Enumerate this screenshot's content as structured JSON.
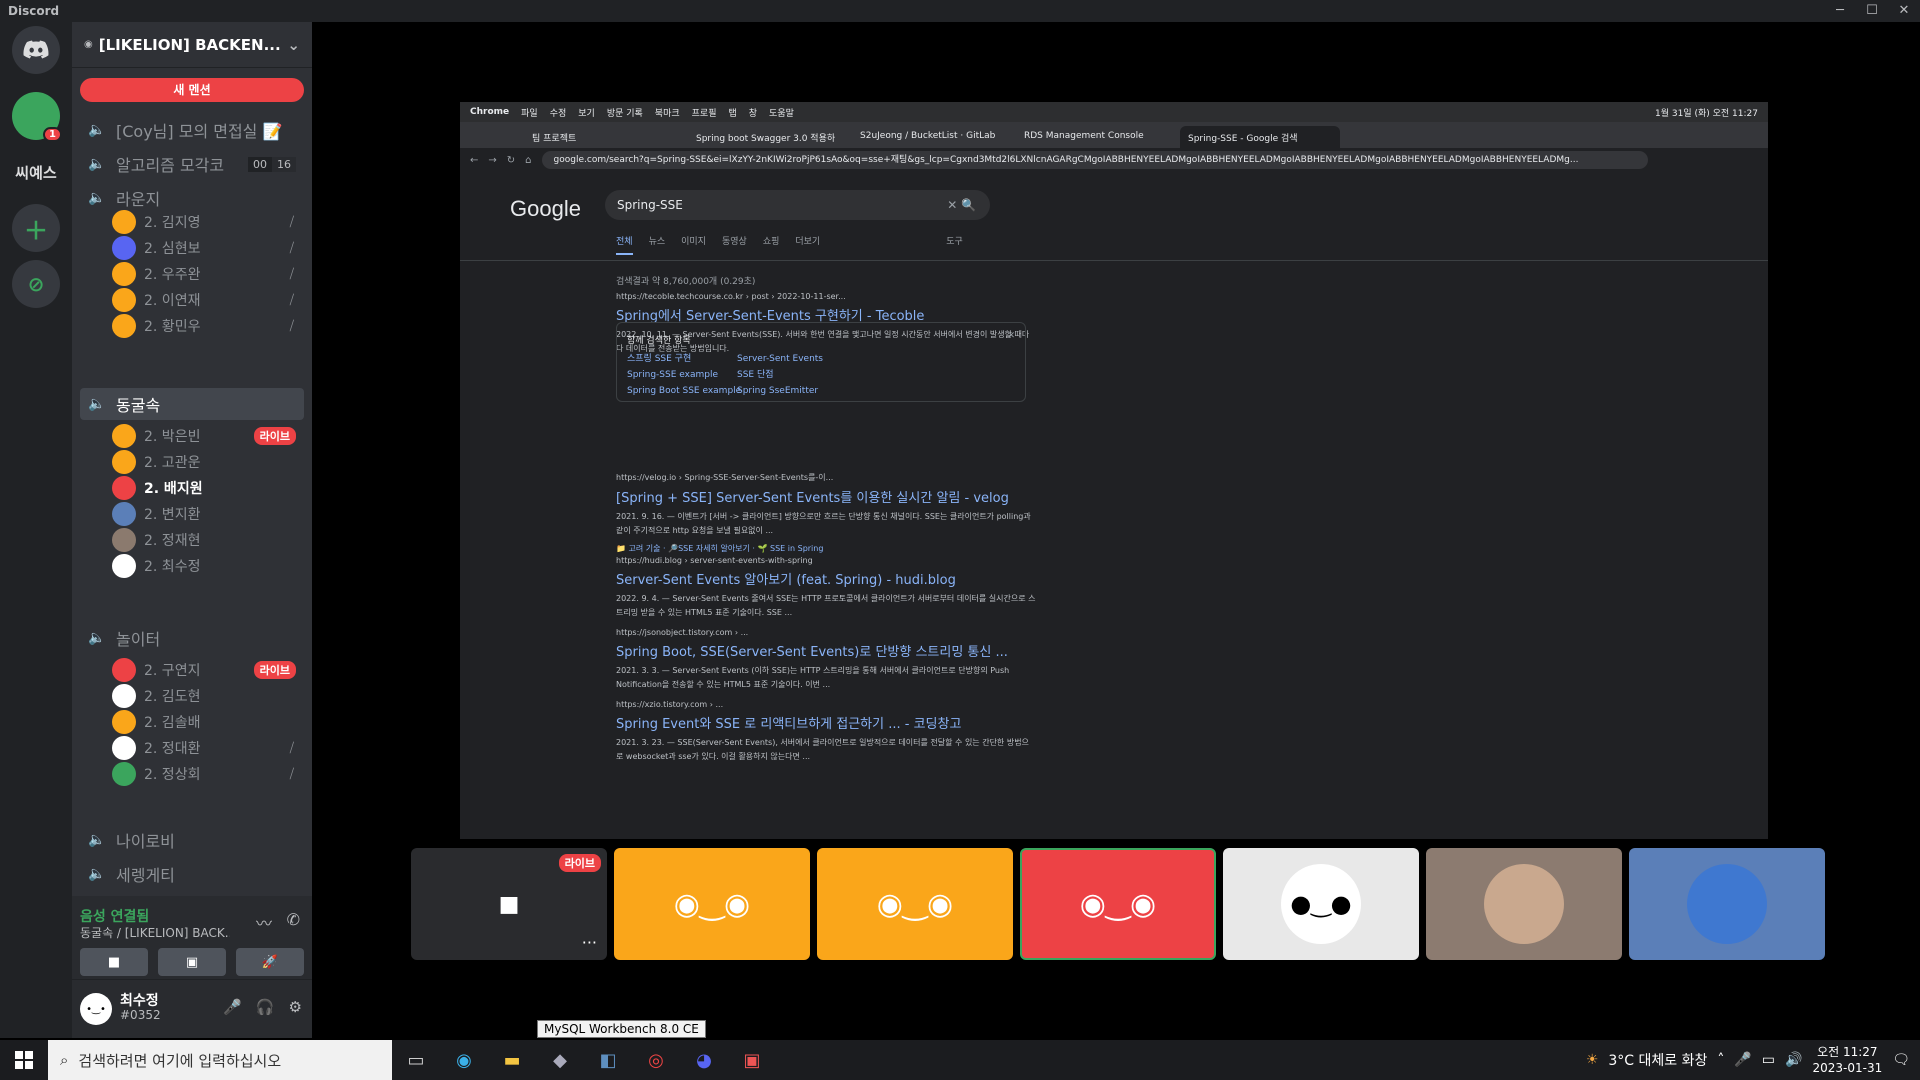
{
  "window": {
    "title": "Discord",
    "min": "─",
    "max": "☐",
    "close": "✕"
  },
  "servers": {
    "sidebar_text_server": "씨예스",
    "notification_count": "1"
  },
  "guild": {
    "name": "[LIKELION] BACKEN...",
    "new_mention": "새 멘션"
  },
  "channels": [
    {
      "label": "[Coy님] 모의 면접실 📝"
    },
    {
      "label": "알고리즘 모각코",
      "count_a": "00",
      "count_b": "16"
    },
    {
      "label": "라운지"
    },
    {
      "label": "동굴속"
    },
    {
      "label": "놀이터"
    },
    {
      "label": "나이로비"
    },
    {
      "label": "세렝게티"
    }
  ],
  "lounge_members": [
    {
      "name": "2. 김지영",
      "color": "#faa61a"
    },
    {
      "name": "2. 심현보",
      "color": "#5865f2"
    },
    {
      "name": "2. 우주완",
      "color": "#faa61a"
    },
    {
      "name": "2. 이연재",
      "color": "#faa61a"
    },
    {
      "name": "2. 황민우",
      "color": "#faa61a"
    }
  ],
  "cave_members": [
    {
      "name": "2. 박은빈",
      "live": "라이브",
      "color": "#faa61a"
    },
    {
      "name": "2. 고관운",
      "color": "#faa61a"
    },
    {
      "name": "2. 배지원",
      "color": "#ed4245"
    },
    {
      "name": "2. 변지환",
      "color": "#5b7fb8"
    },
    {
      "name": "2. 정재현",
      "color": "#8b7a6e"
    },
    {
      "name": "2. 최수정",
      "color": "#ffffff"
    }
  ],
  "play_members": [
    {
      "name": "2. 구연지",
      "live": "라이브",
      "color": "#ed4245"
    },
    {
      "name": "2. 김도현",
      "color": "#ffffff"
    },
    {
      "name": "2. 김솔배",
      "color": "#faa61a"
    },
    {
      "name": "2. 정대환",
      "color": "#ffffff"
    },
    {
      "name": "2. 정상회",
      "color": "#3ba55d"
    }
  ],
  "voice": {
    "status": "음성 연결됨",
    "sub": "동굴속 / [LIKELION] BACK..."
  },
  "user": {
    "name": "최수정",
    "tag": "#0352"
  },
  "browser": {
    "menubar": [
      "Chrome",
      "파일",
      "수정",
      "보기",
      "방문 기록",
      "북마크",
      "프로필",
      "탭",
      "창",
      "도움말"
    ],
    "menubar_right": "1월 31일 (화) 오전 11:27",
    "tabs": [
      "팀 프로젝트",
      "Spring boot Swagger 3.0 적용하",
      "S2uJeong / BucketList · GitLab",
      "RDS Management Console",
      "Spring-SSE - Google 검색"
    ],
    "url": "google.com/search?q=Spring-SSE&ei=lXzYY-2nKIWi2roPjP61sAo&oq=sse+재팅&gs_lcp=Cgxnd3Mtd2l6LXNlcnAGARgCMgoIABBHENYEELADMgoIABBHENYEELADMgoIABBHENYEELADMgoIABBHENYEELADMgoIABBHENYEELADMg..."
  },
  "google": {
    "logo": "Google",
    "query": "Spring-SSE",
    "tabs": [
      "전체",
      "뉴스",
      "이미지",
      "동영상",
      "쇼핑",
      "더보기",
      "도구"
    ],
    "count": "검색결과 약 8,760,000개 (0.29초)",
    "results": [
      {
        "url": "https://tecoble.techcourse.co.kr › post › 2022-10-11-ser...",
        "title": "Spring에서 Server-Sent-Events 구현하기 - Tecoble",
        "snippet": "2022. 10. 11. — Server-Sent Events(SSE). 서버와 한번 연결을 맺고나면 일정 시간동안 서버에서 변경이 발생할 때마다 데이터를 전송받는 방법입니다."
      },
      {
        "url": "https://velog.io › Spring-SSE-Server-Sent-Events를-이...",
        "title": "[Spring + SSE] Server-Sent Events를 이용한 실시간 알림 - velog",
        "snippet": "2021. 9. 16. — 이벤트가 [서버 -> 클라이언트] 방향으로만 흐르는 단방향 통신 채널이다. SSE는 클라이언트가 polling과 같이 주기적으로 http 요청을 보낼 필요없이 ...",
        "links": "📁 고려 기술 · 🔎SSE 자세히 알아보기 · 🌱 SSE in Spring"
      },
      {
        "url": "https://hudi.blog › server-sent-events-with-spring",
        "title": "Server-Sent Events 알아보기 (feat. Spring) - hudi.blog",
        "snippet": "2022. 9. 4. — Server-Sent Events 줄여서 SSE는 HTTP 프로토콜에서 클라이언트가 서버로부터 데이터를 실시간으로 스트리밍 받을 수 있는 HTML5 표준 기술이다. SSE ..."
      },
      {
        "url": "https://jsonobject.tistory.com › ...",
        "title": "Spring Boot, SSE(Server-Sent Events)로 단방향 스트리밍 통신 ...",
        "snippet": "2021. 3. 3. — Server-Sent Events (이하 SSE)는 HTTP 스트리밍을 통해 서버에서 클라이언트로 단방향의 Push Notification을 전송할 수 있는 HTML5 표준 기술이다. 이번 ..."
      },
      {
        "url": "https://xzio.tistory.com › ...",
        "title": "Spring Event와 SSE 로 리액티브하게 접근하기 ... - 코딩창고",
        "snippet": "2021. 3. 23. — SSE(Server-Sent Events), 서버에서 클라이언트로 일방적으로 데이터를 전달할 수 있는 간단한 방법으로 websocket과 sse가 있다. 이걸 활용하지 않는다면 ..."
      }
    ],
    "related_header": "함께 검색한 항목",
    "related": [
      "스프링 SSE 구현",
      "Spring-SSE example",
      "Spring Boot SSE example",
      "Server-Sent Events",
      "SSE 단점",
      "Spring SseEmitter"
    ]
  },
  "tiles": {
    "live_label": "라이브",
    "more": "···"
  },
  "taskbar": {
    "search_placeholder": "검색하려면 여기에 입력하십시오",
    "weather": "3°C 대체로 화창",
    "time": "오전 11:27",
    "date": "2023-01-31",
    "tooltip": "MySQL Workbench 8.0 CE"
  }
}
